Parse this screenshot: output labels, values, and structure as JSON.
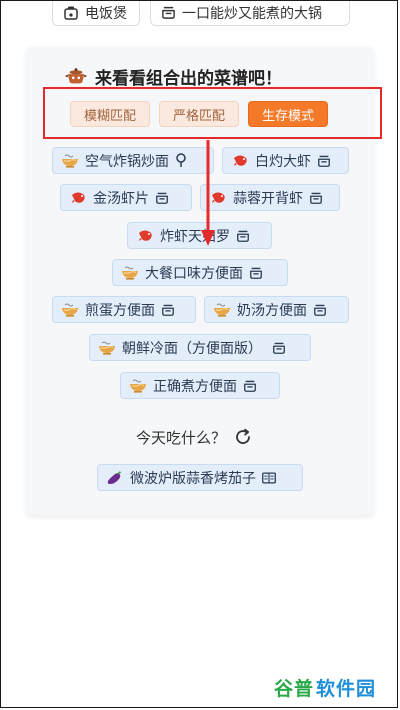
{
  "top_chips": [
    {
      "label": "电饭煲"
    },
    {
      "label": "一口能炒又能煮的大锅"
    }
  ],
  "card": {
    "title": "来看看组合出的菜谱吧！"
  },
  "modes": [
    {
      "label": "模糊匹配",
      "active": false
    },
    {
      "label": "严格匹配",
      "active": false
    },
    {
      "label": "生存模式",
      "active": true
    }
  ],
  "recipes": [
    {
      "label": "空气炸锅炒面",
      "lead_icon": "noodle-bowl-icon",
      "trail_icon": "search-icon"
    },
    {
      "label": "白灼大虾",
      "lead_icon": "shrimp-icon",
      "trail_icon": "pot-icon"
    },
    {
      "label": "金汤虾片",
      "lead_icon": "shrimp-icon",
      "trail_icon": "pot-icon"
    },
    {
      "label": "蒜蓉开背虾",
      "lead_icon": "shrimp-icon",
      "trail_icon": "pot-icon"
    },
    {
      "label": "炸虾天妇罗",
      "lead_icon": "shrimp-icon",
      "trail_icon": "pot-icon"
    },
    {
      "label": "大餐口味方便面",
      "lead_icon": "noodle-bowl-icon",
      "trail_icon": "pot-icon"
    },
    {
      "label": "煎蛋方便面",
      "lead_icon": "noodle-bowl-icon",
      "trail_icon": "pot-icon"
    },
    {
      "label": "奶汤方便面",
      "lead_icon": "noodle-bowl-icon",
      "trail_icon": "pot-icon"
    },
    {
      "label": "朝鲜冷面（方便面版）",
      "lead_icon": "noodle-bowl-icon",
      "trail_icon": "pot-icon"
    },
    {
      "label": "正确煮方便面",
      "lead_icon": "noodle-bowl-icon",
      "trail_icon": "pot-icon"
    }
  ],
  "today": {
    "label": "今天吃什么？"
  },
  "suggestion": {
    "label": "微波炉版蒜香烤茄子",
    "lead_icon": "eggplant-icon",
    "trail_icon": "book-icon"
  },
  "watermark": {
    "part_a": "谷普",
    "part_b": "软件园"
  },
  "colors": {
    "accent": "#f47a2a",
    "highlight_box": "#e42a2a",
    "chip_bg": "#e4eefa"
  }
}
